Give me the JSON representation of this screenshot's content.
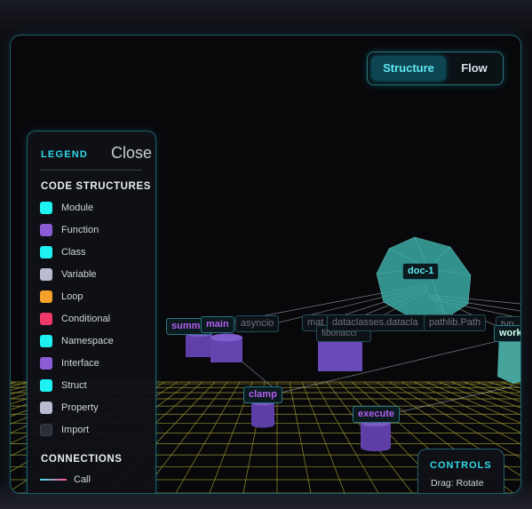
{
  "view_toggle": {
    "structure_label": "Structure",
    "flow_label": "Flow",
    "active": "Structure"
  },
  "legend": {
    "title": "LEGEND",
    "close_label": "Close",
    "code_structures_heading": "CODE STRUCTURES",
    "items": [
      {
        "label": "Module",
        "color": "#1ef2f2"
      },
      {
        "label": "Function",
        "color": "#8a5cd6"
      },
      {
        "label": "Class",
        "color": "#1ef2f2"
      },
      {
        "label": "Variable",
        "color": "#b9bbd0"
      },
      {
        "label": "Loop",
        "color": "#f4a12a"
      },
      {
        "label": "Conditional",
        "color": "#f0386a"
      },
      {
        "label": "Namespace",
        "color": "#1ef2f2"
      },
      {
        "label": "Interface",
        "color": "#8a5cd6"
      },
      {
        "label": "Struct",
        "color": "#1ef2f2"
      },
      {
        "label": "Property",
        "color": "#b9bbd0"
      },
      {
        "label": "Import",
        "color": "#2a2e36"
      }
    ],
    "connections_heading": "CONNECTIONS",
    "connections": [
      {
        "label": "Call"
      }
    ]
  },
  "nodes": {
    "doc": "doc-1",
    "summ": "summ",
    "main": "main",
    "asyncio": "asyncio",
    "mat": "mat",
    "fibonacci": "fibonacci",
    "dataclasses": "dataclasses.datacla",
    "pathlib": "pathlib.Path",
    "typ": "typ",
    "work": "work",
    "clamp": "clamp",
    "execute": "execute"
  },
  "controls": {
    "title": "CONTROLS",
    "drag_hint": "Drag: Rotate"
  },
  "colors": {
    "accent": "#2fd8e6",
    "grid": "#d8d23a",
    "function_node": "#6b46b8",
    "doc_node": "#3fb6ad"
  }
}
